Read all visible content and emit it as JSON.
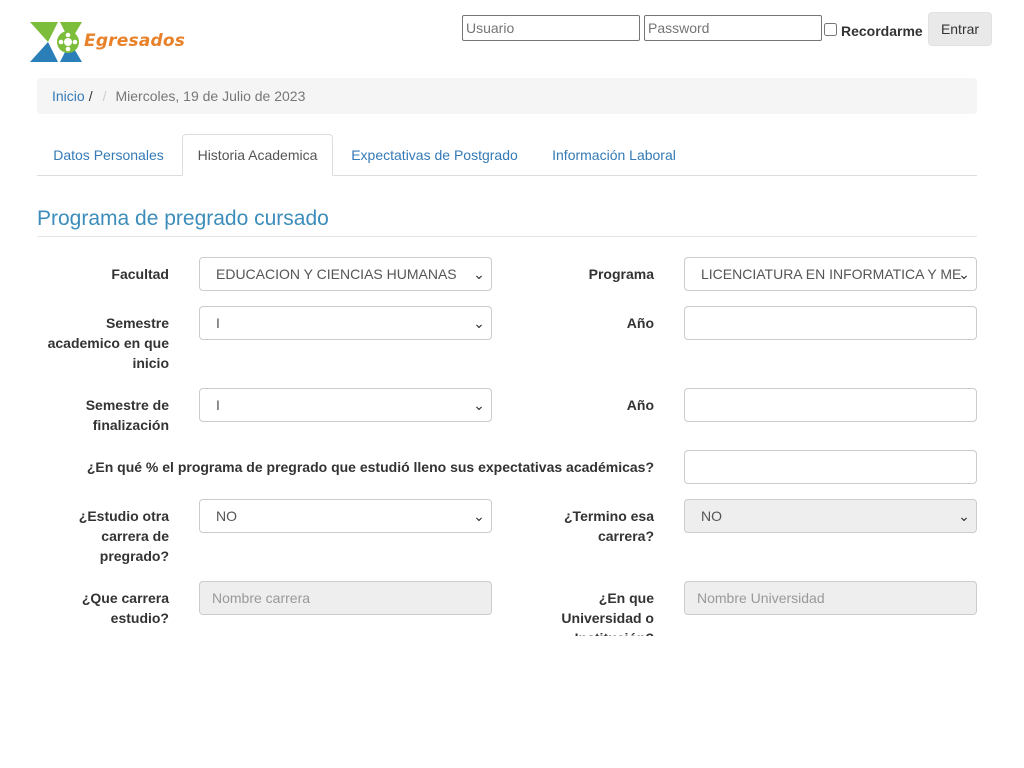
{
  "header": {
    "logo_text": "Egresados",
    "username_placeholder": "Usuario",
    "password_placeholder": "Password",
    "remember_label": "Recordarme",
    "enter_label": "Entrar",
    "colors": {
      "logo_orange": "#e8812a",
      "logo_green": "#7cbd3b",
      "logo_blue": "#2a7fb8"
    }
  },
  "breadcrumb": {
    "home": "Inicio",
    "home_slash": "/",
    "separator": "/",
    "current": "Miercoles, 19 de Julio de 2023"
  },
  "tabs": [
    {
      "label": "Datos Personales",
      "active": false
    },
    {
      "label": "Historia Academica",
      "active": true
    },
    {
      "label": "Expectativas de Postgrado",
      "active": false
    },
    {
      "label": "Información Laboral",
      "active": false
    }
  ],
  "section": {
    "title": "Programa de pregrado cursado"
  },
  "form": {
    "facultad": {
      "label": "Facultad",
      "value": "EDUCACION Y CIENCIAS HUMANAS"
    },
    "programa": {
      "label": "Programa",
      "value": "LICENCIATURA EN INFORMATICA Y MEDIOS AUDIOVISUALES"
    },
    "semestre_inicio": {
      "label_1": "Semestre",
      "label_2": "academico en que",
      "label_3": "inicio",
      "value": "I"
    },
    "anio_inicio": {
      "label": "Año",
      "value": ""
    },
    "semestre_fin": {
      "label_1": "Semestre de",
      "label_2": "finalización",
      "value": "I"
    },
    "anio_fin": {
      "label": "Año",
      "value": ""
    },
    "expectativas": {
      "label": "¿En qué % el programa de pregrado que estudió lleno sus expectativas académicas?",
      "value": ""
    },
    "otra_carrera": {
      "label_1": "¿Estudio otra",
      "label_2": "carrera de",
      "label_3": "pregrado?",
      "value": "NO"
    },
    "termino": {
      "label_1": "¿Termino esa",
      "label_2": "carrera?",
      "value": "NO"
    },
    "que_carrera": {
      "label_1": "¿Que carrera",
      "label_2": "estudio?",
      "placeholder": "Nombre carrera"
    },
    "universidad": {
      "label_1": "¿En que",
      "label_2": "Universidad o",
      "label_3": "Institución?",
      "placeholder": "Nombre Universidad"
    }
  }
}
